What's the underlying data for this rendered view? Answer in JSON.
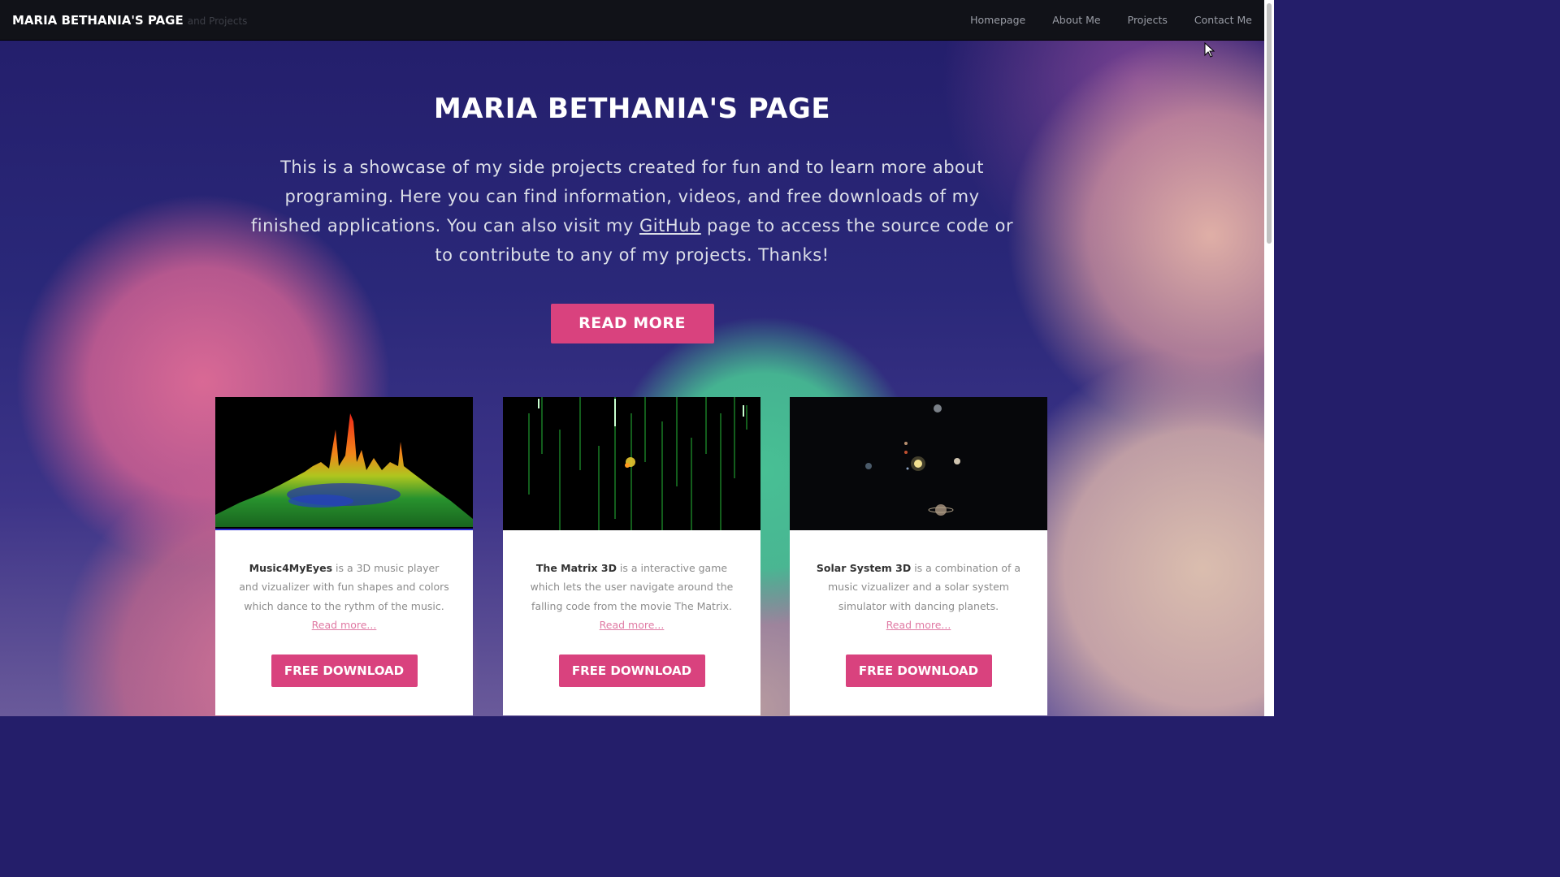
{
  "navbar": {
    "brand": "MARIA BETHANIA'S PAGE",
    "brand_sub": "and Projects",
    "links": [
      "Homepage",
      "About Me",
      "Projects",
      "Contact Me"
    ]
  },
  "hero": {
    "title": "MARIA BETHANIA'S PAGE",
    "text_before": "This is a showcase of my side projects created for fun and to learn more about programing. Here you can find information, videos, and free downloads of my finished applications. You can also visit my ",
    "link": "GitHub",
    "text_after": " page to access the source code or to contribute to any of my projects. Thanks!",
    "button": "READ MORE"
  },
  "cards": [
    {
      "name": "Music4MyEyes",
      "desc": " is a 3D music player and vizualizer with fun shapes and colors which dance to the rythm of the music.",
      "link": "Read more...",
      "button": "FREE DOWNLOAD"
    },
    {
      "name": "The Matrix 3D",
      "desc": " is a interactive game which lets the user navigate around the falling code from the movie The Matrix.",
      "link": "Read more...",
      "button": "FREE DOWNLOAD"
    },
    {
      "name": "Solar System 3D",
      "desc": " is a combination of a music vizualizer and a solar system simulator with dancing planets.",
      "link": "Read more...",
      "button": "FREE DOWNLOAD"
    }
  ],
  "colors": {
    "accent": "#d9427e",
    "navbar": "#111218",
    "link": "#e07aa4"
  }
}
